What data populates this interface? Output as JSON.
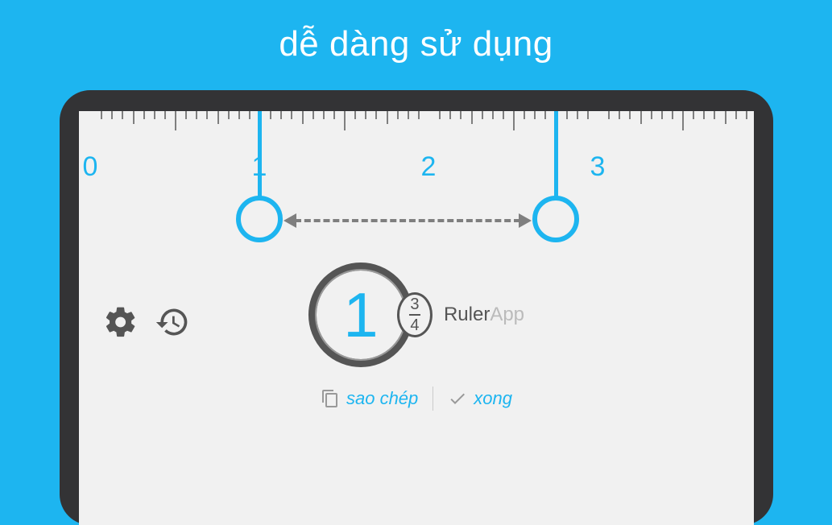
{
  "headline": "dễ dàng sử dụng",
  "ruler": {
    "labels": [
      "0",
      "1",
      "2",
      "3"
    ],
    "unitPx": 210,
    "originPx": 14
  },
  "caliper": {
    "startValue": 1.0,
    "endValue": 2.75
  },
  "measurement": {
    "whole": "1",
    "numerator": "3",
    "denominator": "4"
  },
  "brand": {
    "main": "Ruler",
    "sub": "App"
  },
  "actions": {
    "copy": "sao chép",
    "done": "xong"
  },
  "icons": {
    "settings": "gear-icon",
    "history": "history-icon",
    "copy": "copy-icon",
    "done": "check-icon"
  }
}
